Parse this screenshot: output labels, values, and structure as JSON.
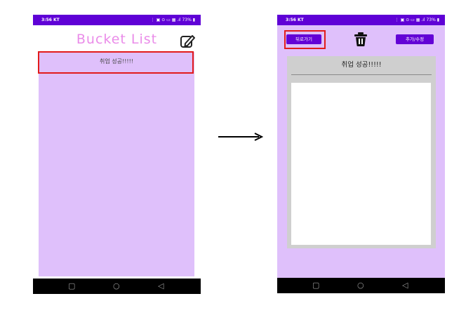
{
  "left_screen": {
    "status": {
      "time": "3:56 KT",
      "indicators": "⋮ ▣ ⊙ ▭ ▦ .ıl 73% ▮"
    },
    "title": "Bucket List",
    "edit_icon": "edit-pencil-icon",
    "list_items": [
      "취업 성공!!!!!"
    ],
    "nav": {
      "recent": "▢",
      "home": "○",
      "back": "◁"
    }
  },
  "arrow_icon": "right-arrow-icon",
  "right_screen": {
    "status": {
      "time": "3:56 KT",
      "indicators": "⋮ ▣ ⊙ ▭ ▦ .ıl 73% ▮"
    },
    "back_button": "뒤로가기",
    "delete_icon": "trash-icon",
    "add_edit_button": "추가/수정",
    "detail_title": "취업 성공!!!!!",
    "nav": {
      "recent": "▢",
      "home": "○",
      "back": "◁"
    }
  },
  "colors": {
    "status_bar": "#5f01d6",
    "list_background": "#dfc0fb",
    "title_pink": "#ea8ce9",
    "button_purple": "#6302d6",
    "highlight_red": "#e21b1b"
  }
}
